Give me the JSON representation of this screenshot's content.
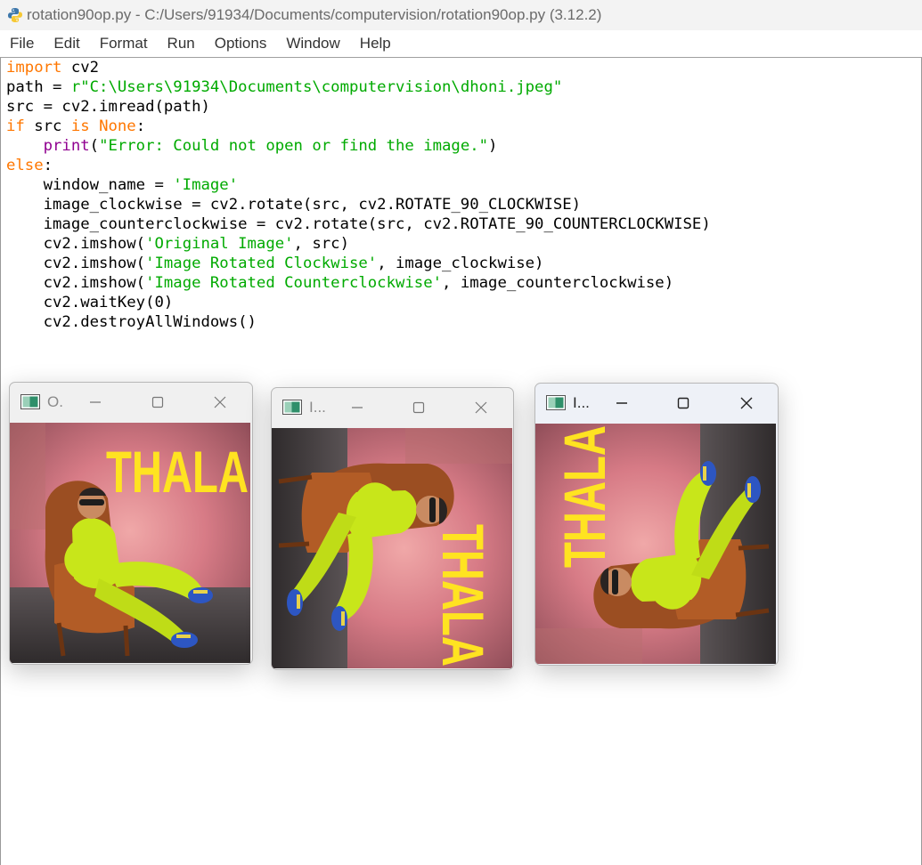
{
  "window": {
    "title": "rotation90op.py - C:/Users/91934/Documents/computervision/rotation90op.py (3.12.2)"
  },
  "menu": [
    "File",
    "Edit",
    "Format",
    "Run",
    "Options",
    "Window",
    "Help"
  ],
  "code": {
    "path_string": "r\"C:\\Users\\91934\\Documents\\computervision\\dhoni.jpeg\"",
    "error_message": "\"Error: Could not open or find the image.\"",
    "window_name_string": "'Image'",
    "original_title_string": "'Original Image'",
    "clockwise_title_string": "'Image Rotated Clockwise'",
    "counterclockwise_title_string": "'Image Rotated Counterclockwise'"
  },
  "image_windows": [
    {
      "title": "O.",
      "image_text": "THALA",
      "rotation": "original"
    },
    {
      "title": "I...",
      "image_text": "THALA",
      "rotation": "clockwise"
    },
    {
      "title": "I...",
      "image_text": "THALA",
      "rotation": "counterclockwise"
    }
  ],
  "colors": {
    "keyword": "#ff7700",
    "string": "#00aa00",
    "builtin": "#900090",
    "image_text": "#ffe321"
  },
  "icons": {
    "app": "python-idle-icon",
    "image_window": "opencv-window-icon",
    "minimize": "minimize-icon",
    "maximize": "maximize-icon",
    "close": "close-icon"
  }
}
